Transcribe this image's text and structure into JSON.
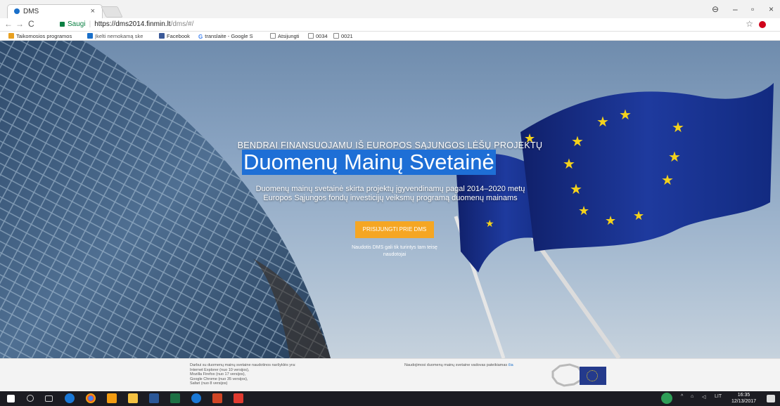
{
  "browser": {
    "tab_title": "DMS",
    "tab_close": "×",
    "security_label": "Saugi",
    "url_host": "https://dms2014.finmin.lt",
    "url_path": "/dms/#/",
    "star": "☆",
    "win_user": "⊖",
    "win_minimize": "–",
    "win_restore": "▫",
    "win_close": "×"
  },
  "bookmarks": [
    {
      "label": "Taikomosios programos",
      "icon": "apps-icon",
      "color": "#e8a020"
    },
    {
      "label": "Įkelti nemokamą ske",
      "icon": "upload-icon",
      "color": "#1a6fc9"
    },
    {
      "label": "Facebook",
      "icon": "facebook-icon",
      "color": "#3b5998"
    },
    {
      "label": "translaite - Google S",
      "icon": "google-icon",
      "color": "#ffffff"
    },
    {
      "label": "Atsijungti",
      "icon": "page-icon",
      "color": "#ffffff"
    },
    {
      "label": "0034",
      "icon": "page-icon",
      "color": "#ffffff"
    },
    {
      "label": "0021",
      "icon": "page-icon",
      "color": "#ffffff"
    }
  ],
  "hero": {
    "subtitle": "BENDRAI FINANSUOJAMU IŠ EUROPOS SĄJUNGOS LĖŠŲ PROJEKTŲ",
    "title": "Duomenų Mainų Svetainė",
    "description": "Duomenų mainų svetainė skirta projektų įgyvendinamų pagal 2014–2020 metų Europos Sąjungos fondų investicijų veiksmų programą duomenų mainams",
    "login_button": "PRISIJUNGTI PRIE DMS",
    "login_note": "Naudotis DMS gali tik turintys tam teisę naudotojai",
    "accent_color": "#f5a623",
    "selection_color": "#1e6fd6"
  },
  "footer": {
    "browsers_intro": "Darbui su duomenų mainų svetaine naudotinos naršyklės yra:",
    "browsers": [
      "Internet Explorer (nuo 10 versijos),",
      "Mozilla Firefox (nuo 17 versijos),",
      "Google Chrome (nuo 35 versijos),",
      "Safari (nuo 8 versijos)"
    ],
    "manual_text": "Naudojimosi duomenų mainų svetaine vadovas pateikiamas",
    "manual_link": "čia"
  },
  "taskbar": {
    "language": "LIT",
    "time": "16:35",
    "date": "12/13/2017"
  }
}
